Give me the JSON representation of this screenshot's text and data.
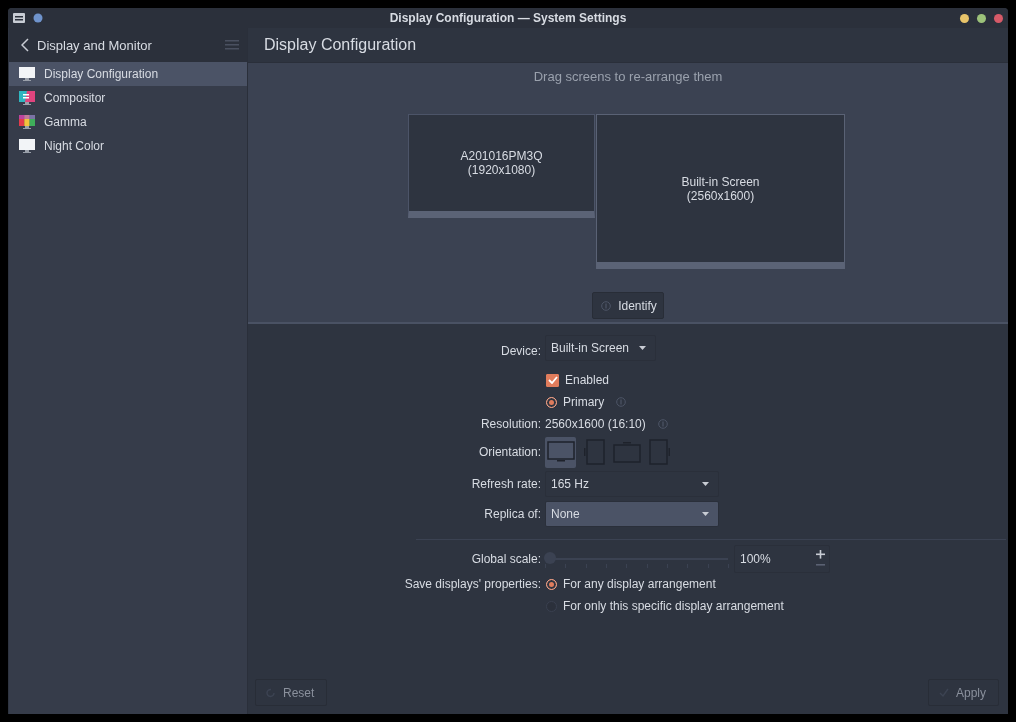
{
  "window": {
    "title": "Display Configuration — System Settings"
  },
  "sidebar": {
    "title": "Display and Monitor",
    "items": [
      {
        "label": "Display Configuration",
        "kind": "monitor",
        "selected": true
      },
      {
        "label": "Compositor",
        "kind": "compositor",
        "selected": false
      },
      {
        "label": "Gamma",
        "kind": "gamma",
        "selected": false
      },
      {
        "label": "Night Color",
        "kind": "monitor",
        "selected": false
      }
    ]
  },
  "page": {
    "title": "Display Configuration",
    "hint": "Drag screens to re-arrange them",
    "screens": [
      {
        "name": "A201016PM3Q",
        "mode": "(1920x1080)",
        "selected": false
      },
      {
        "name": "Built-in Screen",
        "mode": "(2560x1600)",
        "selected": true
      }
    ],
    "identify_button": "Identify",
    "device": {
      "label": "Device:",
      "value": "Built-in Screen"
    },
    "enabled": {
      "label": "Enabled",
      "checked": true
    },
    "primary": {
      "label": "Primary",
      "selected": true
    },
    "resolution": {
      "label": "Resolution:",
      "value": "2560x1600 (16:10)"
    },
    "orientation": {
      "label": "Orientation:",
      "options": [
        {
          "kind": "normal",
          "selected": true
        },
        {
          "kind": "left",
          "selected": false
        },
        {
          "kind": "inverted",
          "selected": false
        },
        {
          "kind": "right",
          "selected": false
        }
      ]
    },
    "refresh_rate": {
      "label": "Refresh rate:",
      "value": "165 Hz"
    },
    "replica_of": {
      "label": "Replica of:",
      "value": "None"
    },
    "global_scale": {
      "label": "Global scale:",
      "level": 0,
      "value": "100%"
    },
    "save_properties": {
      "label": "Save displays' properties:",
      "options": [
        {
          "label": "For any display arrangement",
          "selected": true
        },
        {
          "label": "For only this specific display arrangement",
          "selected": false
        }
      ]
    },
    "buttons": [
      {
        "label": "Reset",
        "kind": "reset",
        "disabled": true
      },
      {
        "label": "Apply",
        "kind": "apply",
        "disabled": true
      }
    ]
  }
}
